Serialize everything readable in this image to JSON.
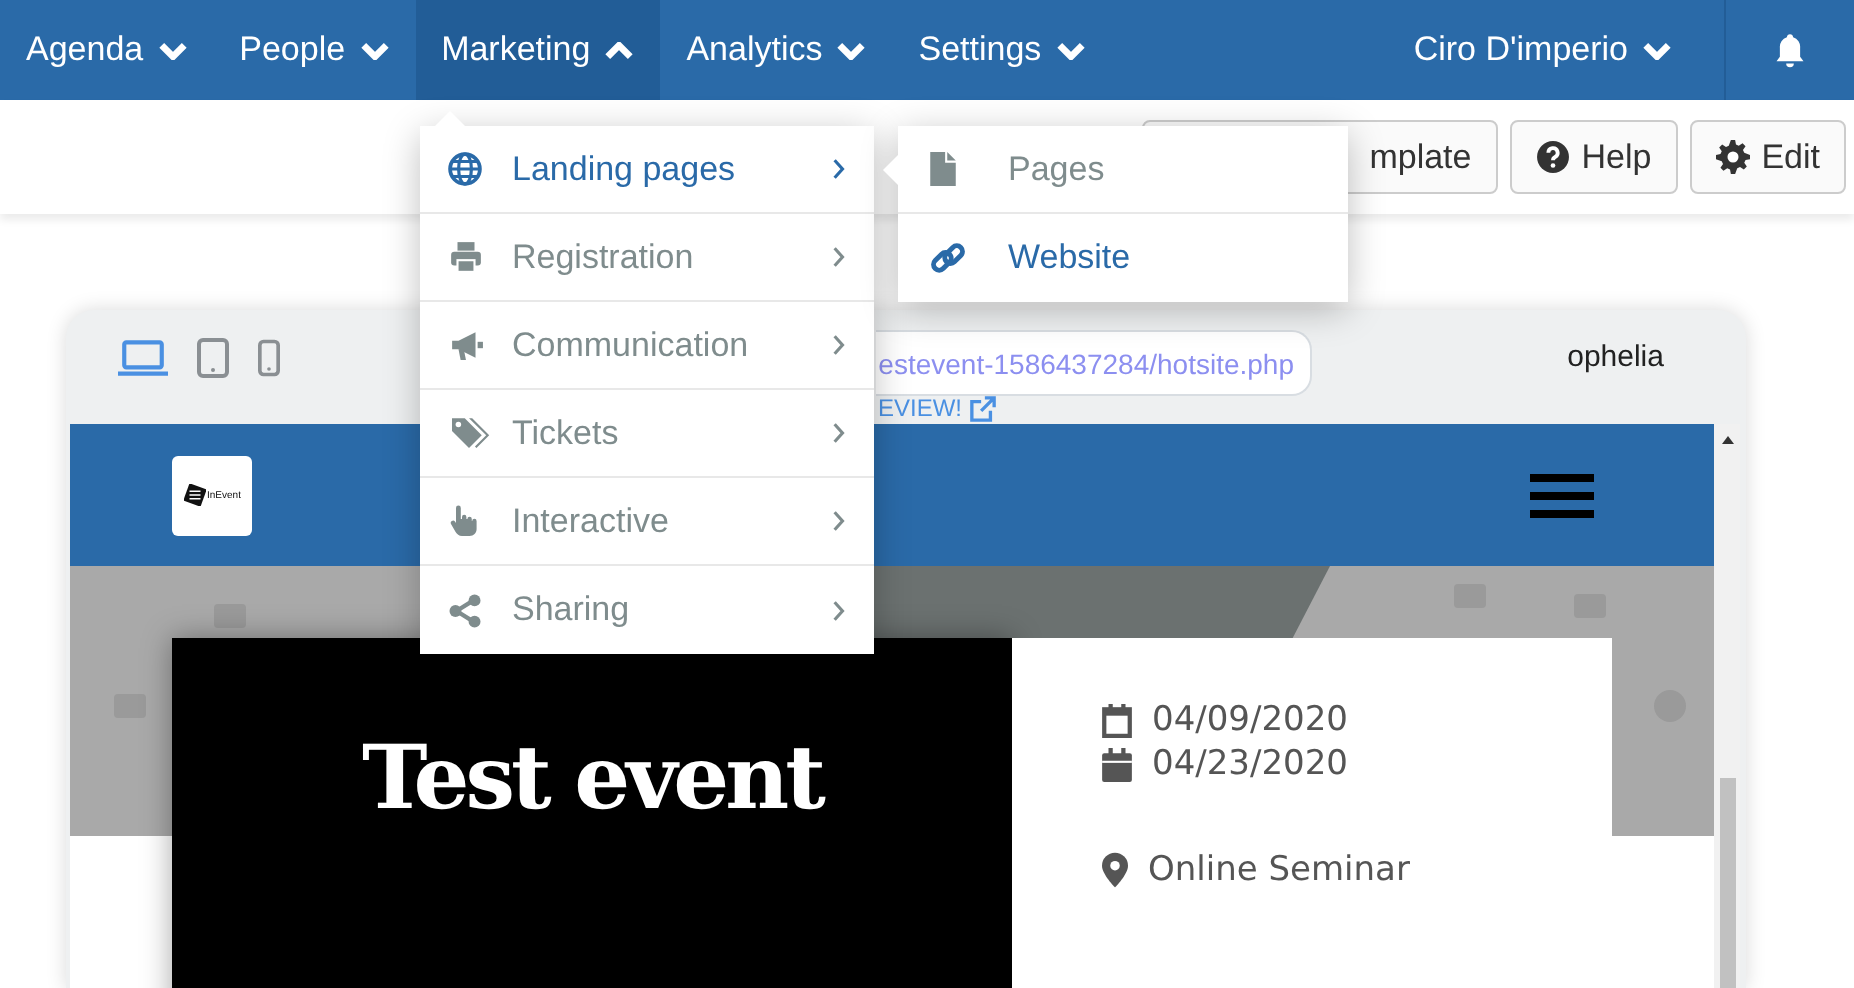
{
  "nav": {
    "items": [
      {
        "label": "Agenda",
        "expanded": false
      },
      {
        "label": "People",
        "expanded": false
      },
      {
        "label": "Marketing",
        "expanded": true
      },
      {
        "label": "Analytics",
        "expanded": false
      },
      {
        "label": "Settings",
        "expanded": false
      }
    ],
    "user": "Ciro D'imperio"
  },
  "toolbar": {
    "buttons": [
      {
        "label": "mplate",
        "kind": "text"
      },
      {
        "label": "Help",
        "kind": "help"
      },
      {
        "label": "Edit",
        "kind": "edit"
      }
    ]
  },
  "menu": {
    "items": [
      {
        "label": "Landing pages",
        "kind": "globe",
        "selected": true
      },
      {
        "label": "Registration",
        "kind": "printer",
        "selected": false
      },
      {
        "label": "Communication",
        "kind": "megaphone",
        "selected": false
      },
      {
        "label": "Tickets",
        "kind": "tags",
        "selected": false
      },
      {
        "label": "Interactive",
        "kind": "hand",
        "selected": false
      },
      {
        "label": "Sharing",
        "kind": "share",
        "selected": false
      }
    ]
  },
  "submenu": {
    "items": [
      {
        "label": "Pages",
        "kind": "file",
        "selected": false
      },
      {
        "label": "Website",
        "kind": "link",
        "selected": true
      }
    ]
  },
  "preview": {
    "devices": [
      {
        "kind": "laptop",
        "selected": true
      },
      {
        "kind": "tablet",
        "selected": false
      },
      {
        "kind": "phone",
        "selected": false
      }
    ],
    "url": "estevent-1586437284/hotsite.php",
    "link": "EVIEW!",
    "account": "ophelia",
    "site": {
      "logo": "InEvent",
      "title": "Test event",
      "dates": [
        {
          "kind": "start",
          "text": "04/09/2020"
        },
        {
          "kind": "end",
          "text": "04/23/2020"
        }
      ],
      "location": "Online Seminar"
    }
  }
}
